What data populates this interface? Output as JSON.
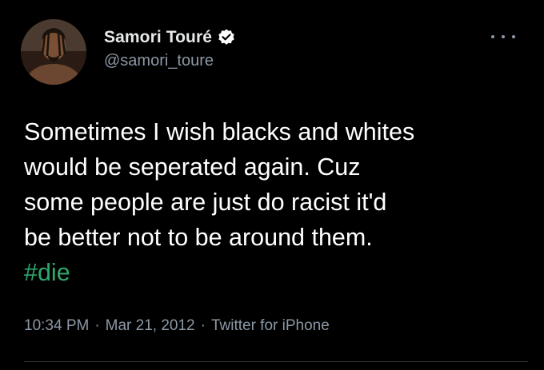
{
  "author": {
    "display_name": "Samori Touré",
    "handle": "@samori_toure",
    "verified": true,
    "avatar": "profile-photo"
  },
  "menu_icon": "more-horizontal-icon",
  "tweet": {
    "text": "Sometimes I wish blacks and whites\nwould be seperated again. Cuz\nsome people are just do racist it'd\nbe better not to be around them.",
    "hashtag": "#die",
    "time": "10:34 PM",
    "separator": "·",
    "date": "Mar 21, 2012",
    "source": "Twitter for iPhone"
  },
  "colors": {
    "background": "#000000",
    "text": "#ffffff",
    "muted": "#8b98a5",
    "hashtag": "#2ea86b",
    "verified_badge": "#ffffff"
  }
}
